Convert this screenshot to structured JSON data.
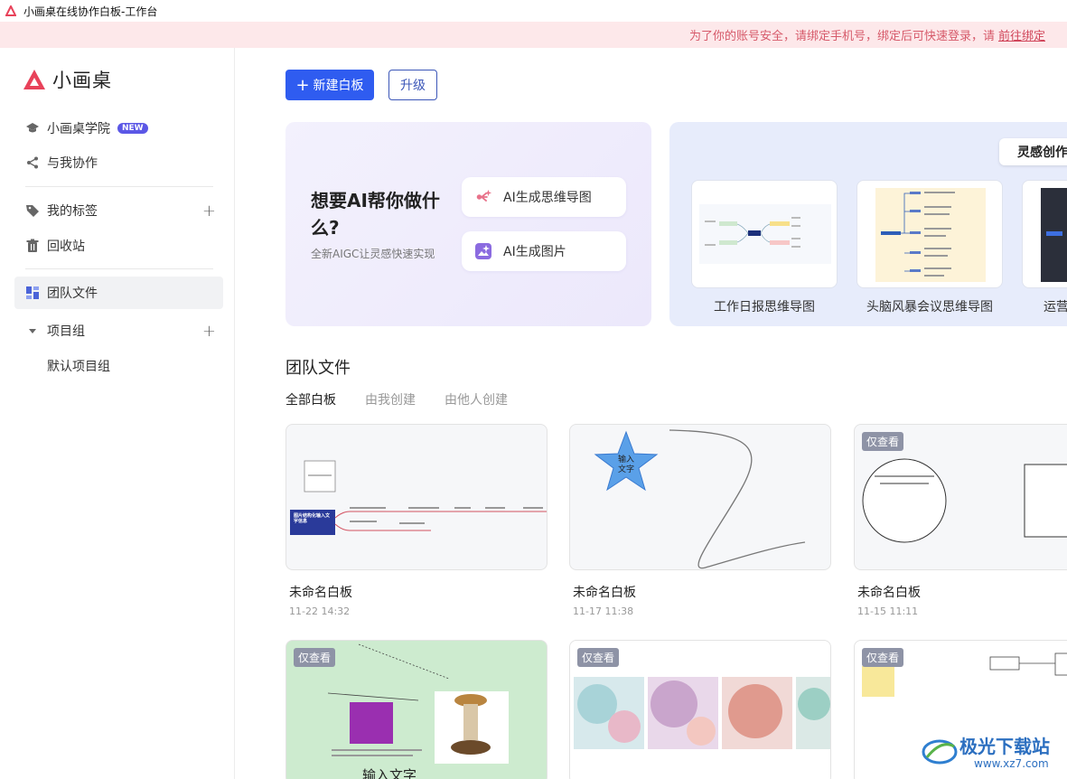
{
  "window": {
    "title": "小画桌在线协作白板-工作台"
  },
  "notice": {
    "text": "为了你的账号安全，请绑定手机号，绑定后可快速登录，请",
    "link": "前往绑定"
  },
  "brand": {
    "name": "小画桌",
    "accent": "#e8425a"
  },
  "sidebar": {
    "items": [
      {
        "label": "小画桌学院",
        "badge": "NEW"
      },
      {
        "label": "与我协作"
      },
      {
        "label": "我的标签"
      },
      {
        "label": "回收站"
      },
      {
        "label": "团队文件"
      },
      {
        "label": "项目组"
      },
      {
        "label": "默认项目组"
      }
    ]
  },
  "toolbar": {
    "new_label": "新建白板",
    "new_icon": "+",
    "upgrade_label": "升级",
    "primary": "#2f5cf0"
  },
  "ai": {
    "title": "想要AI帮你做什么?",
    "subtitle": "全新AIGC让灵感快速实现",
    "buttons": [
      {
        "label": "AI生成思维导图"
      },
      {
        "label": "AI生成图片"
      }
    ]
  },
  "inspiration": {
    "tab_label": "灵感创作",
    "templates": [
      {
        "label": "工作日报思维导图"
      },
      {
        "label": "头脑风暴会议思维导图"
      },
      {
        "label": "运营"
      }
    ]
  },
  "team": {
    "title": "团队文件",
    "tabs": [
      {
        "label": "全部白板"
      },
      {
        "label": "由我创建"
      },
      {
        "label": "由他人创建"
      }
    ],
    "cards": [
      {
        "title": "未命名白板",
        "date": "11-22 14:32"
      },
      {
        "title": "未命名白板",
        "date": "11-17 11:38"
      },
      {
        "title": "未命名白板",
        "date": "11-15 11:11",
        "badge": "仅查看"
      },
      {
        "badge": "仅查看",
        "text": "输入文字"
      },
      {
        "badge": "仅查看"
      },
      {
        "badge": "仅查看"
      }
    ],
    "card1_node": "图片结构化输入文字信息",
    "star_text": "输入文字"
  },
  "watermark": {
    "title": "极光下载站",
    "url": "www.xz7.com"
  }
}
